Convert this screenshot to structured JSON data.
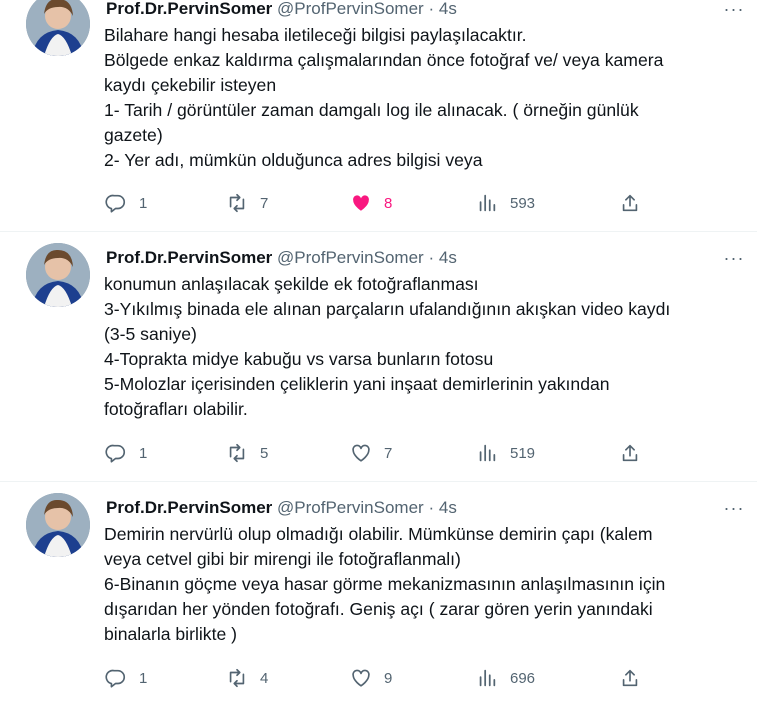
{
  "tweets": [
    {
      "author": "Prof.Dr.PervinSomer",
      "handle": "@ProfPervinSomer",
      "separator": "·",
      "time": "4s",
      "more": "···",
      "lines": [
        "Bilahare hangi hesaba iletileceği bilgisi paylaşılacaktır.",
        "Bölgede enkaz kaldırma çalışmalarından önce fotoğraf ve/ veya kamera",
        "kaydı çekebilir isteyen",
        "1- Tarih / görüntüler zaman damgalı log ile alınacak. ( örneğin günlük",
        "gazete)",
        "2- Yer adı, mümkün olduğunca adres bilgisi veya"
      ],
      "replies": "1",
      "retweets": "7",
      "likes": "8",
      "liked": true,
      "views": "593"
    },
    {
      "author": "Prof.Dr.PervinSomer",
      "handle": "@ProfPervinSomer",
      "separator": "·",
      "time": "4s",
      "more": "···",
      "lines": [
        "konumun anlaşılacak şekilde ek fotoğraflanması",
        "3-Yıkılmış binada ele alınan parçaların ufalandığının akışkan video kaydı",
        "(3-5 saniye)",
        "4-Toprakta midye kabuğu vs varsa bunların fotosu",
        "5-Molozlar içerisinden çeliklerin yani inşaat demirlerinin yakından",
        "fotoğrafları olabilir."
      ],
      "replies": "1",
      "retweets": "5",
      "likes": "7",
      "liked": false,
      "views": "519"
    },
    {
      "author": "Prof.Dr.PervinSomer",
      "handle": "@ProfPervinSomer",
      "separator": "·",
      "time": "4s",
      "more": "···",
      "lines": [
        "Demirin nervürlü olup olmadığı olabilir. Mümkünse demirin çapı (kalem",
        "veya cetvel gibi bir mirengi ile fotoğraflanmalı)",
        "6-Binanın göçme veya hasar görme mekanizmasının anlaşılmasının için",
        "dışarıdan her yönden fotoğrafı. Geniş açı ( zarar gören yerin yanındaki",
        "binalarla birlikte )"
      ],
      "replies": "1",
      "retweets": "4",
      "likes": "9",
      "liked": false,
      "views": "696"
    }
  ],
  "colors": {
    "text": "#0f1419",
    "muted": "#536471",
    "like": "#f91880",
    "divider": "#eff3f4"
  },
  "icons": [
    "reply-icon",
    "retweet-icon",
    "like-icon",
    "views-icon",
    "share-icon",
    "more-icon"
  ]
}
